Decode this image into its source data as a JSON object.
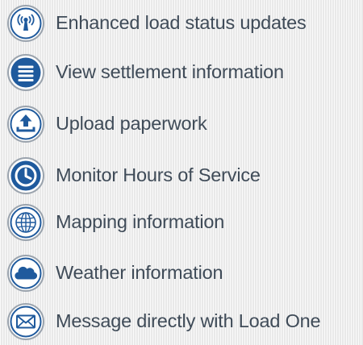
{
  "colors": {
    "icon_blue": "#1f5a9d",
    "ring_gray": "#9aa3ad",
    "text": "#3f4b58"
  },
  "features": [
    {
      "label": "Enhanced load status updates",
      "icon": "radio-tower-icon"
    },
    {
      "label": "View settlement information",
      "icon": "menu-list-icon"
    },
    {
      "label": "Upload paperwork",
      "icon": "upload-tray-icon"
    },
    {
      "label": "Monitor Hours of Service",
      "icon": "clock-icon"
    },
    {
      "label": "Mapping information",
      "icon": "globe-icon"
    },
    {
      "label": "Weather information",
      "icon": "cloud-icon"
    },
    {
      "label": "Message directly with Load One",
      "icon": "envelope-icon"
    }
  ]
}
